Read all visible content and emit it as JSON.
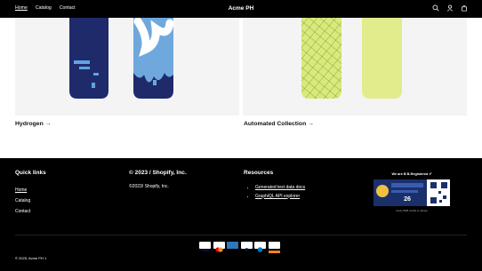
{
  "header": {
    "brand": "Acme PH",
    "nav": [
      "Home",
      "Catalog",
      "Contact"
    ]
  },
  "collections": [
    {
      "title": "Hydrogen →"
    },
    {
      "title": "Automated Collection →"
    }
  ],
  "footer": {
    "quick_links": {
      "heading": "Quick links",
      "items": [
        "Home",
        "Catalog",
        "Contact"
      ]
    },
    "about": {
      "heading": "© 2023 / Shopify, Inc.",
      "text": "©2023/ Shopify, Inc."
    },
    "resources": {
      "heading": "Resources",
      "items": [
        "Generated test data docs",
        "GraphiQL API explorer"
      ]
    },
    "badge": {
      "title": "We are B B-Registered ✔",
      "year": "26",
      "caption": "Verify B2B profile & ratings"
    },
    "payment_icons": [
      "visa-icon",
      "mastercard-icon",
      "amex-icon",
      "paypal-icon",
      "diners-icon",
      "discover-icon"
    ],
    "copyright": "© 2025, Acme PH 1"
  },
  "colors": {
    "background": "#000000",
    "card_bg": "#f4f4f4",
    "board_navy": "#1f2a6b",
    "board_blue": "#6fa8dc",
    "board_yellow": "#d9ea7a"
  }
}
